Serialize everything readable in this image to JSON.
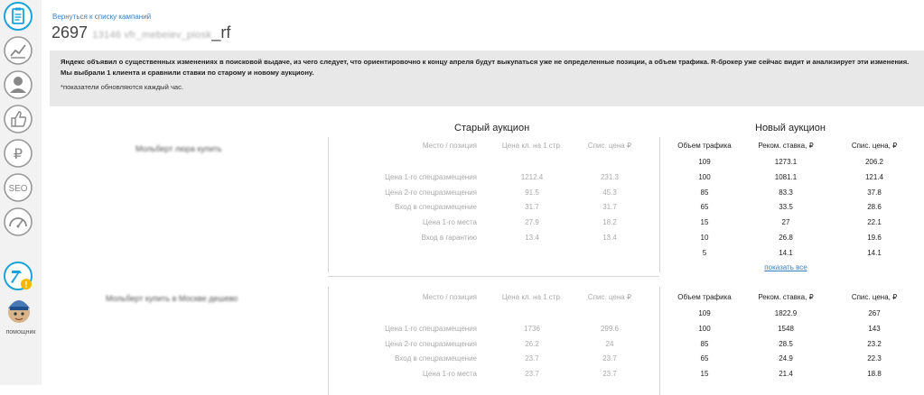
{
  "sidebar": {
    "helper_label": "помощник"
  },
  "header": {
    "back_link": "Вернуться к списку кампаний",
    "campaign_id": "2697",
    "campaign_name_blurred": "13146 vfr_mebeiev_piosk",
    "campaign_suffix": "_rf"
  },
  "notice": {
    "text": "Яндекс объявил о существенных изменениях в поисковой выдаче, из чего следует, что ориентировочно к концу апреля будут выкупаться уже не определенные позиции, а объем трафика. R-брокер уже сейчас видит и анализирует эти изменения. Мы выбрали 1 клиента и сравнили ставки по старому и новому аукциону.",
    "note": "*показатели обновляются каждый час."
  },
  "headings": {
    "old": "Старый аукцион",
    "new": "Новый аукцион"
  },
  "old_columns": {
    "position": "Место / позиция",
    "price": "Цена кл. на 1 стр.",
    "spend": "Спис. цена ₽"
  },
  "new_columns": {
    "traffic": "Объем трафика",
    "bid": "Реком. ставка, ₽",
    "spend": "Спис. цена, ₽"
  },
  "show_all": "показать все",
  "blocks": [
    {
      "keyword": "Мольберт люра купить",
      "old_rows": [
        {
          "position": "Цена 1-го спецразмещения",
          "price": "1212.4",
          "spend": "231.3"
        },
        {
          "position": "Цена 2-го спецразмещения",
          "price": "91.5",
          "spend": "45.3"
        },
        {
          "position": "Вход в спецразмещение",
          "price": "31.7",
          "spend": "31.7"
        },
        {
          "position": "Цена 1-го места",
          "price": "27.9",
          "spend": "18.2"
        },
        {
          "position": "Вход в гарантию",
          "price": "13.4",
          "spend": "13.4"
        }
      ],
      "new_rows": [
        {
          "traffic": "109",
          "bid": "1273.1",
          "spend": "206.2"
        },
        {
          "traffic": "100",
          "bid": "1081.1",
          "spend": "121.4"
        },
        {
          "traffic": "85",
          "bid": "83.3",
          "spend": "37.8"
        },
        {
          "traffic": "65",
          "bid": "33.5",
          "spend": "28.6"
        },
        {
          "traffic": "15",
          "bid": "27",
          "spend": "22.1"
        },
        {
          "traffic": "10",
          "bid": "26.8",
          "spend": "19.6"
        },
        {
          "traffic": "5",
          "bid": "14.1",
          "spend": "14.1"
        }
      ]
    },
    {
      "keyword": "Мольберт купить в Москве дешево",
      "old_rows": [
        {
          "position": "Цена 1-го спецразмещения",
          "price": "1736",
          "spend": "299.6"
        },
        {
          "position": "Цена 2-го спецразмещения",
          "price": "26.2",
          "spend": "24"
        },
        {
          "position": "Вход в спецразмещение",
          "price": "23.7",
          "spend": "23.7"
        },
        {
          "position": "Цена 1-го места",
          "price": "23.7",
          "spend": "23.7"
        }
      ],
      "new_rows": [
        {
          "traffic": "109",
          "bid": "1822.9",
          "spend": "267"
        },
        {
          "traffic": "100",
          "bid": "1548",
          "spend": "143"
        },
        {
          "traffic": "85",
          "bid": "28.5",
          "spend": "23.2"
        },
        {
          "traffic": "65",
          "bid": "24.9",
          "spend": "22.3"
        },
        {
          "traffic": "15",
          "bid": "21.4",
          "spend": "18.8"
        }
      ]
    }
  ]
}
